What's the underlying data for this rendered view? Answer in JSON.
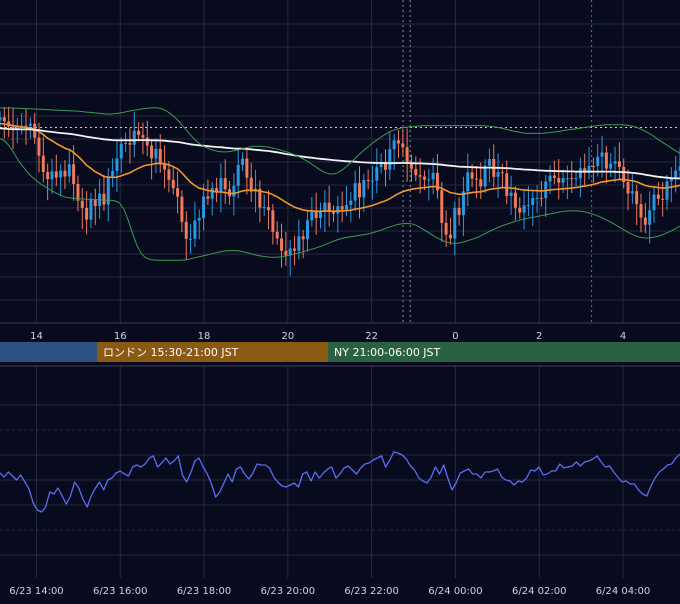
{
  "sessions": [
    {
      "id": "tokyo",
      "label": "",
      "color": "#2c5282"
    },
    {
      "id": "london",
      "label": "ロンドン 15:30-21:00 JST",
      "color": "#8a5a14"
    },
    {
      "id": "ny",
      "label": "NY 21:00-06:00 JST",
      "color": "#286240"
    }
  ],
  "colors": {
    "background": "#080a1e",
    "grid": "#262a40",
    "up_candle": "#2a98e0",
    "down_candle": "#f07a5a",
    "ma_short": "#f0962c",
    "ma_long": "#f2f2f2",
    "bollinger": "#3e9a52",
    "oscillator": "#5a6ef2",
    "axis_text": "#cfd3e0"
  },
  "chart_data": [
    {
      "type": "candlestick",
      "xlabel": "",
      "ylabel": "",
      "x_ticks": [
        "14",
        "16",
        "18",
        "20",
        "22",
        "0",
        "2",
        "4"
      ],
      "x_tick_hours": [
        14,
        16,
        18,
        20,
        22,
        24,
        26,
        28
      ],
      "x_range_hours": [
        13.13,
        29.36
      ],
      "y_range": [
        0,
        100
      ],
      "grid": true,
      "reference_lines": {
        "dashed_price_level": 85,
        "vertical_dashed_hours": [
          22.75,
          22.92,
          27.25
        ]
      },
      "candles_close": [
        89.9,
        87.9,
        85.4,
        84.6,
        85.6,
        85.9,
        85.8,
        86.8,
        80.2,
        71.6,
        63.8,
        60.4,
        64.1,
        61.2,
        64.5,
        61.7,
        67.5,
        58.1,
        50.1,
        46.7,
        41.1,
        50.9,
        47.6,
        53.5,
        48.3,
        61.6,
        64.3,
        70.3,
        77.3,
        77.6,
        76.8,
        83.5,
        81.4,
        80.2,
        76.4,
        70.3,
        74.8,
        67.5,
        65.0,
        60.1,
        56.1,
        52.1,
        40.1,
        32.0,
        32.0,
        40.7,
        41.9,
        52.2,
        51.1,
        56.1,
        54.5,
        60.9,
        55.6,
        52.2,
        57.2,
        67.2,
        70.2,
        61.1,
        54.5,
        55.8,
        46.9,
        47.1,
        45.6,
        35.3,
        32.2,
        26.3,
        24.1,
        27.4,
        26.3,
        33.2,
        31.8,
        40.8,
        44.9,
        41.9,
        45.2,
        49.2,
        44.9,
        44.0,
        47.5,
        45.9,
        48.1,
        50.2,
        58.5,
        51.7,
        60.0,
        59.7,
        59.7,
        66.1,
        68.6,
        64.9,
        74.7,
        78.9,
        77.4,
        75.6,
        68.2,
        65.3,
        62.3,
        61.6,
        60.2,
        60.3,
        63.4,
        55.1,
        39.6,
        34.0,
        32.2,
        46.7,
        43.3,
        54.6,
        63.6,
        60.7,
        60.3,
        56.9,
        66.8,
        70.0,
        61.5,
        63.7,
        63.2,
        52.4,
        54.0,
        46.8,
        44.5,
        47.9,
        48.1,
        51.4,
        51.5,
        51.4,
        59.3,
        62.1,
        61.0,
        58.7,
        60.9,
        60.9,
        60.8,
        60.8,
        65.6,
        63.4,
        66.7,
        66.6,
        71.1,
        73.1,
        65.4,
        67.8,
        68.9,
        66.2,
        59.0,
        53.6,
        54.7,
        48.5,
        42.1,
        38.7,
        45.6,
        53.1,
        51.0,
        50.6,
        59.4,
        61.1,
        64.5,
        66.5
      ],
      "series": [
        {
          "name": "",
          "kind": "ma_short",
          "values": [
            86.9,
            86.6,
            86.3,
            85.9,
            85.6,
            85.2,
            85.0,
            84.8,
            84.1,
            83.0,
            81.6,
            79.9,
            78.7,
            77.4,
            76.3,
            75.1,
            74.5,
            73.1,
            71.3,
            69.3,
            67.0,
            65.5,
            63.9,
            62.9,
            61.6,
            61.4,
            61.2,
            61.4,
            62.0,
            62.7,
            63.4,
            64.6,
            65.6,
            66.5,
            67.2,
            67.4,
            67.9,
            67.9,
            67.7,
            67.2,
            66.4,
            65.3,
            63.4,
            61.1,
            58.9,
            57.4,
            56.1,
            55.6,
            55.0,
            54.7,
            54.3,
            54.3,
            54.0,
            53.6,
            53.6,
            54.1,
            54.8,
            55.1,
            55.1,
            55.1,
            54.7,
            54.3,
            53.9,
            53.0,
            52.0,
            50.7,
            49.4,
            48.2,
            47.1,
            46.4,
            45.7,
            45.4,
            45.3,
            45.1,
            45.1,
            45.2,
            45.2,
            45.1,
            45.2,
            45.3,
            45.4,
            45.6,
            46.2,
            46.4,
            46.9,
            47.4,
            47.9,
            48.6,
            49.4,
            50.1,
            51.1,
            52.4,
            53.5,
            54.5,
            55.1,
            55.6,
            55.9,
            56.2,
            56.4,
            56.6,
            56.9,
            56.8,
            56.0,
            55.0,
            54.0,
            53.6,
            53.2,
            53.3,
            53.7,
            54.0,
            54.3,
            54.4,
            54.9,
            55.5,
            55.8,
            56.1,
            56.4,
            56.3,
            56.2,
            55.9,
            55.5,
            55.3,
            55.1,
            55.0,
            54.9,
            54.8,
            55.0,
            55.3,
            55.5,
            55.6,
            55.8,
            56.0,
            56.2,
            56.4,
            56.8,
            57.1,
            57.5,
            57.9,
            58.5,
            59.1,
            59.4,
            59.7,
            60.0,
            60.3,
            60.2,
            59.9,
            59.6,
            59.1,
            58.3,
            57.4,
            56.9,
            56.7,
            56.4,
            56.1,
            56.3,
            56.6,
            57.0,
            57.5
          ]
        },
        {
          "name": "",
          "kind": "ma_long",
          "values": [
            84.6,
            84.5,
            84.3,
            84.2,
            84.2,
            84.1,
            84.1,
            84.1,
            83.9,
            83.7,
            83.4,
            83.1,
            82.9,
            82.6,
            82.4,
            82.2,
            82.0,
            81.7,
            81.4,
            81.0,
            80.6,
            80.3,
            80.0,
            79.7,
            79.4,
            79.2,
            79.0,
            78.9,
            78.9,
            78.9,
            78.9,
            78.9,
            79.0,
            79.0,
            79.0,
            78.9,
            78.9,
            78.8,
            78.7,
            78.5,
            78.3,
            78.1,
            77.8,
            77.4,
            77.0,
            76.7,
            76.5,
            76.3,
            76.1,
            75.9,
            75.7,
            75.6,
            75.4,
            75.2,
            75.0,
            74.9,
            74.9,
            74.8,
            74.6,
            74.4,
            74.2,
            74.0,
            73.8,
            73.5,
            73.2,
            72.8,
            72.4,
            72.1,
            71.7,
            71.4,
            71.1,
            70.8,
            70.6,
            70.3,
            70.1,
            69.9,
            69.7,
            69.5,
            69.3,
            69.1,
            68.9,
            68.8,
            68.7,
            68.5,
            68.4,
            68.3,
            68.2,
            68.1,
            68.1,
            68.0,
            68.0,
            68.0,
            68.1,
            68.1,
            68.1,
            68.0,
            67.9,
            67.9,
            67.8,
            67.7,
            67.6,
            67.5,
            67.3,
            67.0,
            66.8,
            66.6,
            66.4,
            66.3,
            66.2,
            66.1,
            66.0,
            65.9,
            65.9,
            65.9,
            65.8,
            65.8,
            65.7,
            65.6,
            65.5,
            65.3,
            65.2,
            65.0,
            64.9,
            64.8,
            64.6,
            64.5,
            64.4,
            64.4,
            64.3,
            64.2,
            64.2,
            64.1,
            64.1,
            64.0,
            64.0,
            64.0,
            64.0,
            64.0,
            64.0,
            64.0,
            64.0,
            64.0,
            63.9,
            63.8,
            63.7,
            63.6,
            63.4,
            63.2,
            62.9,
            62.5,
            62.2,
            61.8,
            61.5,
            61.3,
            61.1,
            60.9,
            60.8,
            60.7
          ]
        },
        {
          "name": "",
          "kind": "bollinger_upper",
          "values": [
            94.3,
            94.3,
            94.3,
            94.3,
            94.2,
            94.1,
            94.0,
            93.9,
            93.8,
            93.7,
            93.6,
            93.5,
            93.4,
            93.3,
            93.2,
            93.1,
            93.0,
            92.9,
            92.8,
            92.6,
            92.4,
            92.2,
            92.0,
            91.8,
            91.6,
            91.4,
            91.4,
            91.6,
            91.9,
            92.3,
            92.7,
            93.1,
            93.4,
            93.8,
            94.1,
            94.3,
            94.4,
            94.3,
            93.8,
            92.8,
            91.3,
            89.6,
            87.6,
            85.2,
            82.7,
            80.4,
            78.4,
            76.8,
            75.6,
            74.7,
            74.1,
            73.6,
            73.4,
            73.4,
            73.6,
            74.0,
            74.5,
            75.1,
            75.6,
            76.0,
            76.1,
            76.0,
            75.8,
            75.5,
            75.1,
            74.6,
            74.0,
            73.4,
            72.7,
            71.9,
            71.0,
            69.9,
            68.7,
            67.4,
            66.0,
            64.6,
            63.5,
            62.9,
            62.9,
            63.5,
            64.7,
            66.4,
            68.3,
            70.3,
            72.2,
            74.0,
            75.7,
            77.4,
            78.9,
            80.3,
            81.6,
            82.8,
            83.7,
            84.4,
            84.8,
            85.1,
            85.3,
            85.5,
            85.7,
            85.9,
            85.9,
            85.9,
            85.9,
            85.9,
            85.9,
            85.9,
            85.9,
            85.9,
            85.9,
            85.9,
            85.9,
            85.9,
            85.9,
            85.8,
            85.7,
            85.5,
            85.2,
            84.8,
            84.3,
            83.8,
            83.3,
            82.9,
            82.5,
            82.3,
            82.2,
            82.2,
            82.2,
            82.3,
            82.5,
            82.7,
            83.0,
            83.3,
            83.6,
            83.9,
            84.2,
            84.5,
            84.8,
            85.1,
            85.4,
            85.7,
            86.0,
            86.2,
            86.3,
            86.3,
            86.3,
            86.3,
            86.2,
            86.0,
            85.6,
            85.0,
            84.1,
            83.1,
            81.9,
            80.6,
            79.2,
            77.8,
            76.5,
            75.2,
            73.9,
            72.7
          ]
        },
        {
          "name": "",
          "kind": "bollinger_lower",
          "values": [
            79.7,
            78.8,
            76.6,
            73.6,
            70.3,
            67.3,
            64.7,
            62.4,
            60.5,
            58.9,
            57.5,
            56.2,
            55.0,
            53.9,
            52.9,
            52.0,
            51.5,
            51.3,
            51.1,
            51.0,
            50.9,
            50.8,
            50.7,
            50.6,
            50.5,
            50.4,
            50.3,
            50.0,
            49.0,
            46.0,
            40.8,
            34.5,
            28.9,
            25.1,
            23.1,
            22.2,
            21.9,
            21.8,
            21.8,
            21.8,
            21.8,
            21.8,
            21.8,
            21.9,
            22.2,
            22.7,
            23.2,
            23.6,
            24.1,
            24.6,
            25.1,
            25.6,
            26.0,
            26.3,
            26.4,
            26.4,
            26.2,
            25.8,
            25.3,
            24.7,
            24.2,
            23.8,
            23.5,
            23.3,
            23.2,
            23.3,
            23.5,
            23.9,
            24.4,
            24.9,
            25.4,
            25.9,
            26.5,
            27.1,
            27.7,
            28.4,
            29.2,
            30.1,
            30.9,
            31.6,
            32.2,
            32.6,
            33.0,
            33.3,
            33.6,
            33.9,
            34.3,
            34.8,
            35.4,
            36.1,
            36.8,
            37.5,
            38.2,
            38.8,
            39.2,
            39.3,
            39.2,
            38.7,
            37.7,
            36.5,
            35.2,
            33.9,
            32.7,
            31.6,
            30.7,
            30.1,
            29.8,
            29.9,
            30.3,
            30.9,
            31.5,
            32.2,
            33.0,
            34.0,
            35.1,
            36.1,
            37.0,
            37.9,
            38.6,
            39.3,
            40.0,
            40.6,
            41.1,
            41.6,
            42.0,
            42.4,
            42.8,
            43.2,
            43.6,
            44.0,
            44.4,
            44.8,
            45.1,
            45.3,
            45.4,
            45.3,
            45.1,
            44.7,
            44.1,
            43.5,
            42.7,
            41.8,
            40.8,
            39.7,
            38.5,
            37.3,
            36.1,
            34.9,
            33.9,
            33.1,
            32.6,
            32.4,
            32.5,
            32.8,
            33.3,
            34.0,
            34.9,
            35.8,
            36.9,
            38.1
          ]
        }
      ]
    },
    {
      "type": "line",
      "xlabel": "",
      "ylabel": "",
      "x_ticks": [
        "6/23 14:00",
        "6/23 16:00",
        "6/23 18:00",
        "6/23 20:00",
        "6/23 22:00",
        "6/24 00:00",
        "6/24 02:00",
        "6/24 04:00"
      ],
      "x_tick_hours": [
        14,
        16,
        18,
        20,
        22,
        24,
        26,
        28
      ],
      "x_range_hours": [
        13.13,
        29.36
      ],
      "y_range": [
        0,
        100
      ],
      "grid": true,
      "series": [
        {
          "name": "",
          "values": [
            57,
            53,
            58,
            54,
            50,
            55,
            48,
            41,
            27,
            20,
            18,
            23,
            38,
            36,
            42,
            34,
            26,
            34,
            48,
            42,
            31,
            23,
            34,
            42,
            48,
            40,
            50,
            52,
            57,
            59,
            56,
            54,
            63,
            65,
            63,
            66,
            72,
            74,
            63,
            67,
            72,
            66,
            69,
            74,
            55,
            48,
            57,
            69,
            72,
            63,
            56,
            46,
            33,
            38,
            47,
            56,
            48,
            61,
            63,
            56,
            51,
            57,
            66,
            65,
            65,
            62,
            53,
            48,
            44,
            43,
            45,
            47,
            43,
            56,
            58,
            49,
            58,
            52,
            57,
            61,
            63,
            52,
            56,
            62,
            64,
            60,
            56,
            62,
            66,
            67,
            70,
            72,
            74,
            63,
            70,
            78,
            77,
            75,
            71,
            64,
            60,
            52,
            49,
            47,
            53,
            63,
            56,
            65,
            52,
            40,
            47,
            57,
            59,
            61,
            56,
            56,
            52,
            58,
            58,
            59,
            61,
            53,
            50,
            49,
            45,
            49,
            48,
            52,
            60,
            59,
            63,
            55,
            56,
            59,
            59,
            66,
            62,
            63,
            64,
            68,
            64,
            68,
            69,
            71,
            74,
            68,
            63,
            64,
            58,
            53,
            48,
            49,
            46,
            46,
            40,
            36,
            34,
            44,
            52,
            58,
            61,
            65,
            66,
            72,
            76
          ]
        }
      ]
    }
  ]
}
